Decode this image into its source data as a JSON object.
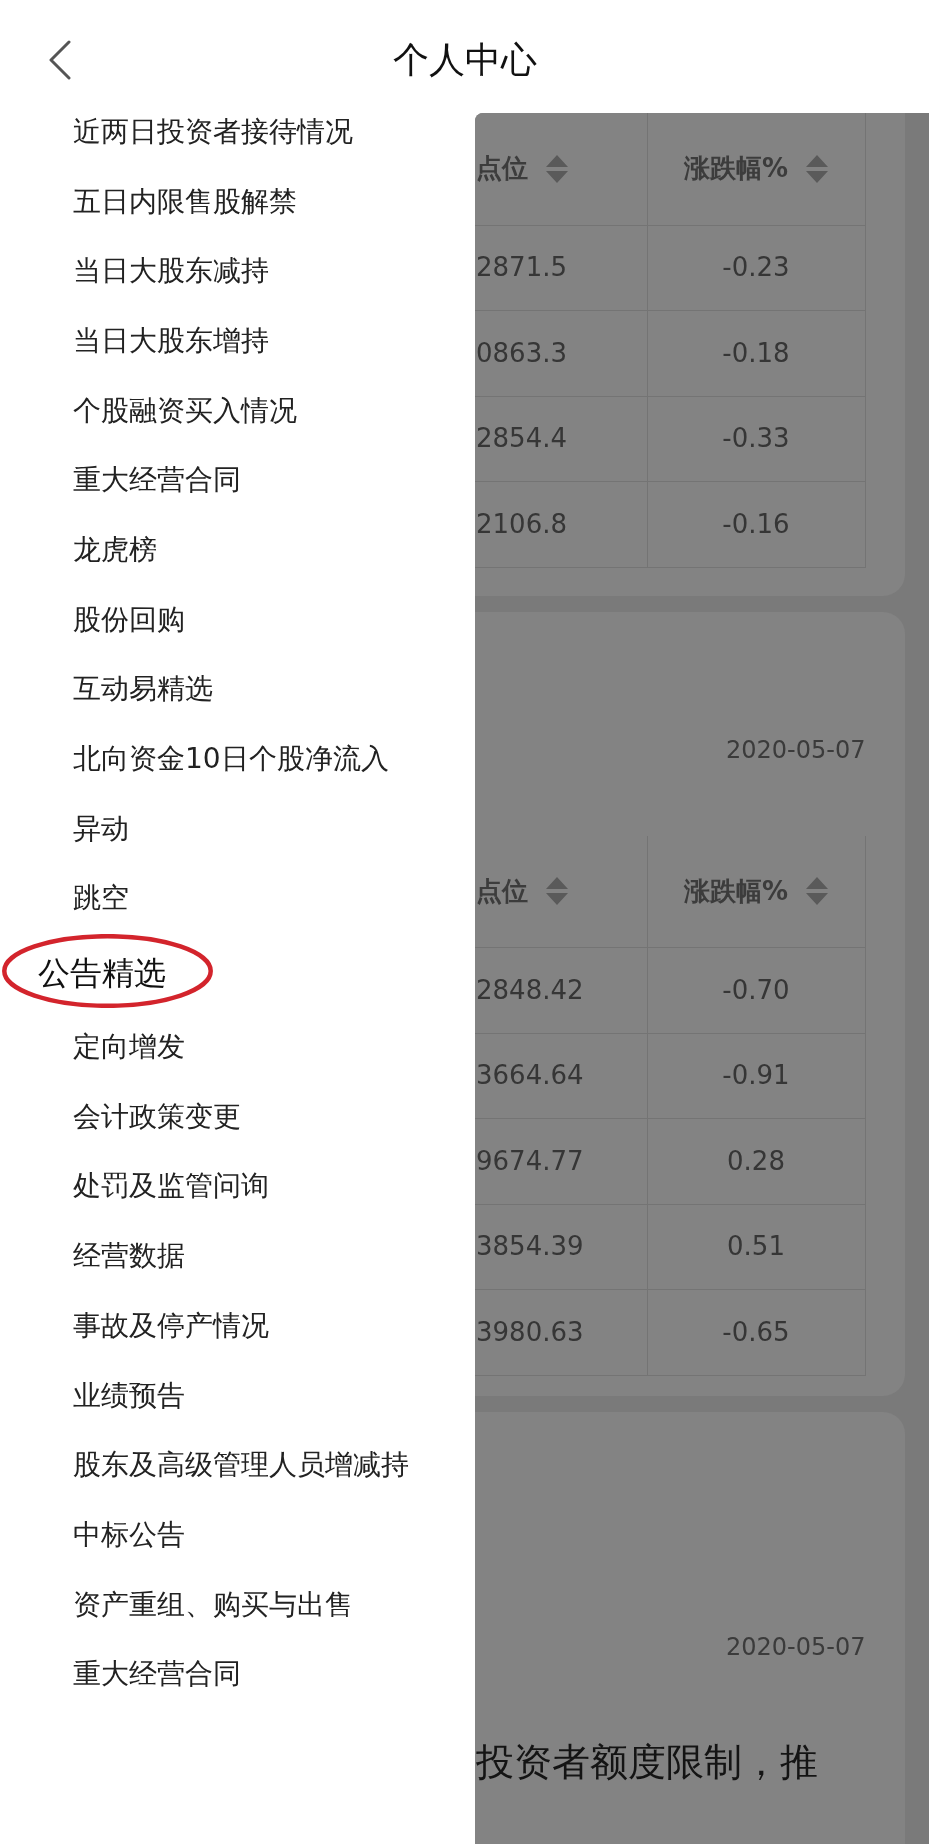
{
  "header": {
    "title": "个人中心"
  },
  "drawer": {
    "items": [
      {
        "kind": "item",
        "label": "近两日投资者接待情况",
        "circled": false
      },
      {
        "kind": "item",
        "label": "五日内限售股解禁",
        "circled": false
      },
      {
        "kind": "item",
        "label": "当日大股东减持",
        "circled": false
      },
      {
        "kind": "item",
        "label": "当日大股东增持",
        "circled": false
      },
      {
        "kind": "item",
        "label": "个股融资买入情况",
        "circled": false
      },
      {
        "kind": "item",
        "label": "重大经营合同",
        "circled": false
      },
      {
        "kind": "item",
        "label": "龙虎榜",
        "circled": false
      },
      {
        "kind": "item",
        "label": "股份回购",
        "circled": false
      },
      {
        "kind": "item",
        "label": "互动易精选",
        "circled": false
      },
      {
        "kind": "item",
        "label": "北向资金10日个股净流入",
        "circled": false
      },
      {
        "kind": "item",
        "label": "异动",
        "circled": false
      },
      {
        "kind": "item",
        "label": "跳空",
        "circled": false
      },
      {
        "kind": "section",
        "label": "公告精选",
        "circled": true
      },
      {
        "kind": "item",
        "label": "定向增发",
        "circled": false
      },
      {
        "kind": "item",
        "label": "会计政策变更",
        "circled": false
      },
      {
        "kind": "item",
        "label": "处罚及监管问询",
        "circled": false
      },
      {
        "kind": "item",
        "label": "经营数据",
        "circled": false
      },
      {
        "kind": "item",
        "label": "事故及停产情况",
        "circled": false
      },
      {
        "kind": "item",
        "label": "业绩预告",
        "circled": false
      },
      {
        "kind": "item",
        "label": "股东及高级管理人员增减持",
        "circled": false
      },
      {
        "kind": "item",
        "label": "中标公告",
        "circled": false
      },
      {
        "kind": "item",
        "label": "资产重组、购买与出售",
        "circled": false
      },
      {
        "kind": "item",
        "label": "重大经营合同",
        "circled": false
      }
    ]
  },
  "content": {
    "cards": [
      {
        "table": {
          "columns": [
            "点位",
            "涨跌幅%"
          ],
          "rows": [
            [
              "2871.5",
              "-0.23"
            ],
            [
              "0863.3",
              "-0.18"
            ],
            [
              "2854.4",
              "-0.33"
            ],
            [
              "2106.8",
              "-0.16"
            ]
          ]
        }
      },
      {
        "date": "2020-05-07",
        "table": {
          "columns": [
            "点位",
            "涨跌幅%"
          ],
          "rows": [
            [
              "2848.42",
              "-0.70"
            ],
            [
              "3664.64",
              "-0.91"
            ],
            [
              "9674.77",
              "0.28"
            ],
            [
              "3854.39",
              "0.51"
            ],
            [
              "3980.63",
              "-0.65"
            ]
          ]
        }
      },
      {
        "date": "2020-05-07",
        "text": "投资者额度限制，推"
      }
    ]
  }
}
